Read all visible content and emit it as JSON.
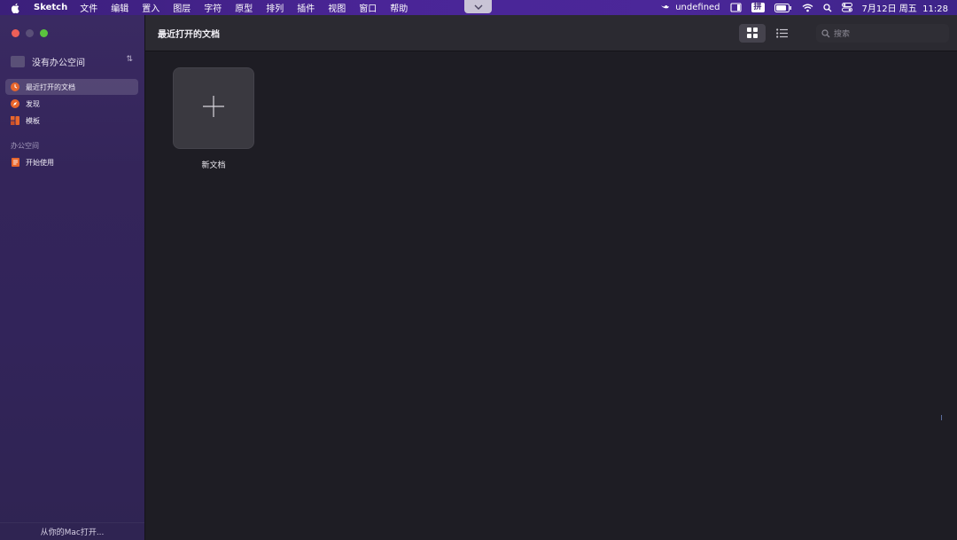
{
  "menubar": {
    "app_name": "Sketch",
    "menus": [
      "文件",
      "编辑",
      "置入",
      "图层",
      "字符",
      "原型",
      "排列",
      "插件",
      "视图",
      "窗口",
      "帮助"
    ],
    "status_text": "undefined",
    "ime_label": "拼",
    "datetime": "7月12日 周五  11:28",
    "icons": [
      "apple-icon",
      "chevron-down-icon",
      "bird-icon",
      "display-icon",
      "battery-icon",
      "wifi-icon",
      "search-icon",
      "control-center-icon"
    ]
  },
  "sidebar": {
    "workspace": "没有办公空间",
    "items": [
      {
        "label": "最近打开的文档",
        "icon": "clock-icon",
        "active": true
      },
      {
        "label": "发现",
        "icon": "compass-icon",
        "active": false
      },
      {
        "label": "模板",
        "icon": "template-icon",
        "active": false
      }
    ],
    "section_label": "办公空间",
    "section_items": [
      {
        "label": "开始使用",
        "icon": "document-icon"
      }
    ],
    "footer": "从你的Mac打开..."
  },
  "toolbar": {
    "title": "最近打开的文档",
    "search_placeholder": "搜索"
  },
  "content": {
    "new_doc_label": "新文档"
  },
  "colors": {
    "accent_orange": "#e8662c",
    "traffic_red": "#ec5f58",
    "traffic_yellow": "#5a4f78",
    "traffic_green": "#5bc23e"
  }
}
